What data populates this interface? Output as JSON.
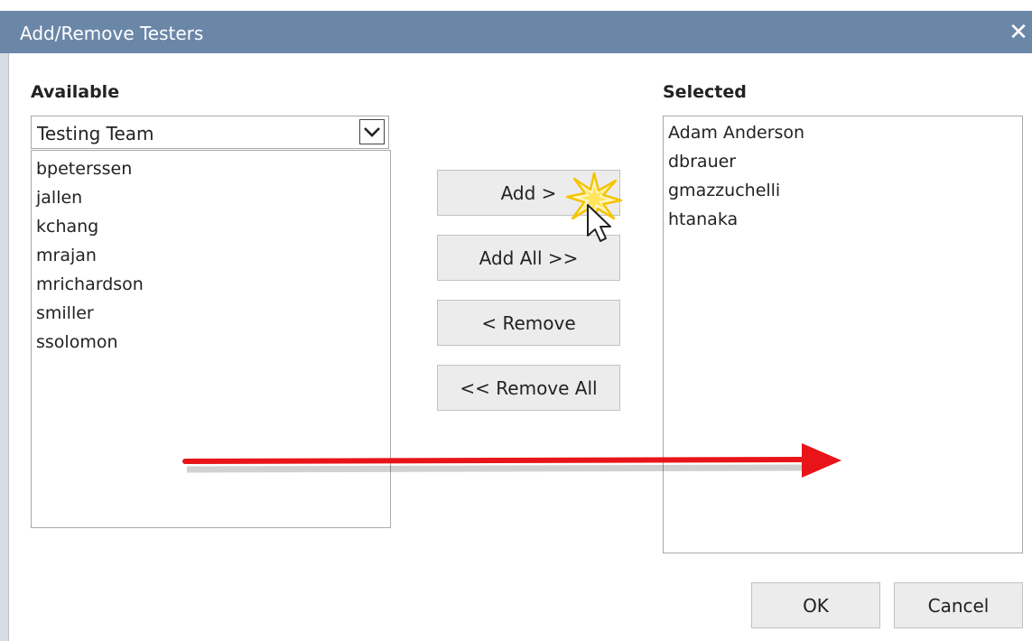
{
  "dialog": {
    "title": "Add/Remove Testers",
    "close_glyph": "✕"
  },
  "available": {
    "heading": "Available",
    "group_value": "Testing Team",
    "items": [
      "bpeterssen",
      "jallen",
      "kchang",
      "mrajan",
      "mrichardson",
      "smiller",
      "ssolomon"
    ]
  },
  "actions": {
    "add": "Add >",
    "add_all": "Add All >>",
    "remove": "< Remove",
    "remove_all": "<< Remove All"
  },
  "selected": {
    "heading": "Selected",
    "items": [
      "Adam Anderson",
      "dbrauer",
      "gmazzuchelli",
      "htanaka"
    ]
  },
  "footer": {
    "ok": "OK",
    "cancel": "Cancel"
  },
  "colors": {
    "titlebar": "#6b87a8",
    "annotation_arrow": "#e8141a",
    "cursor_burst": "#f5c400"
  }
}
